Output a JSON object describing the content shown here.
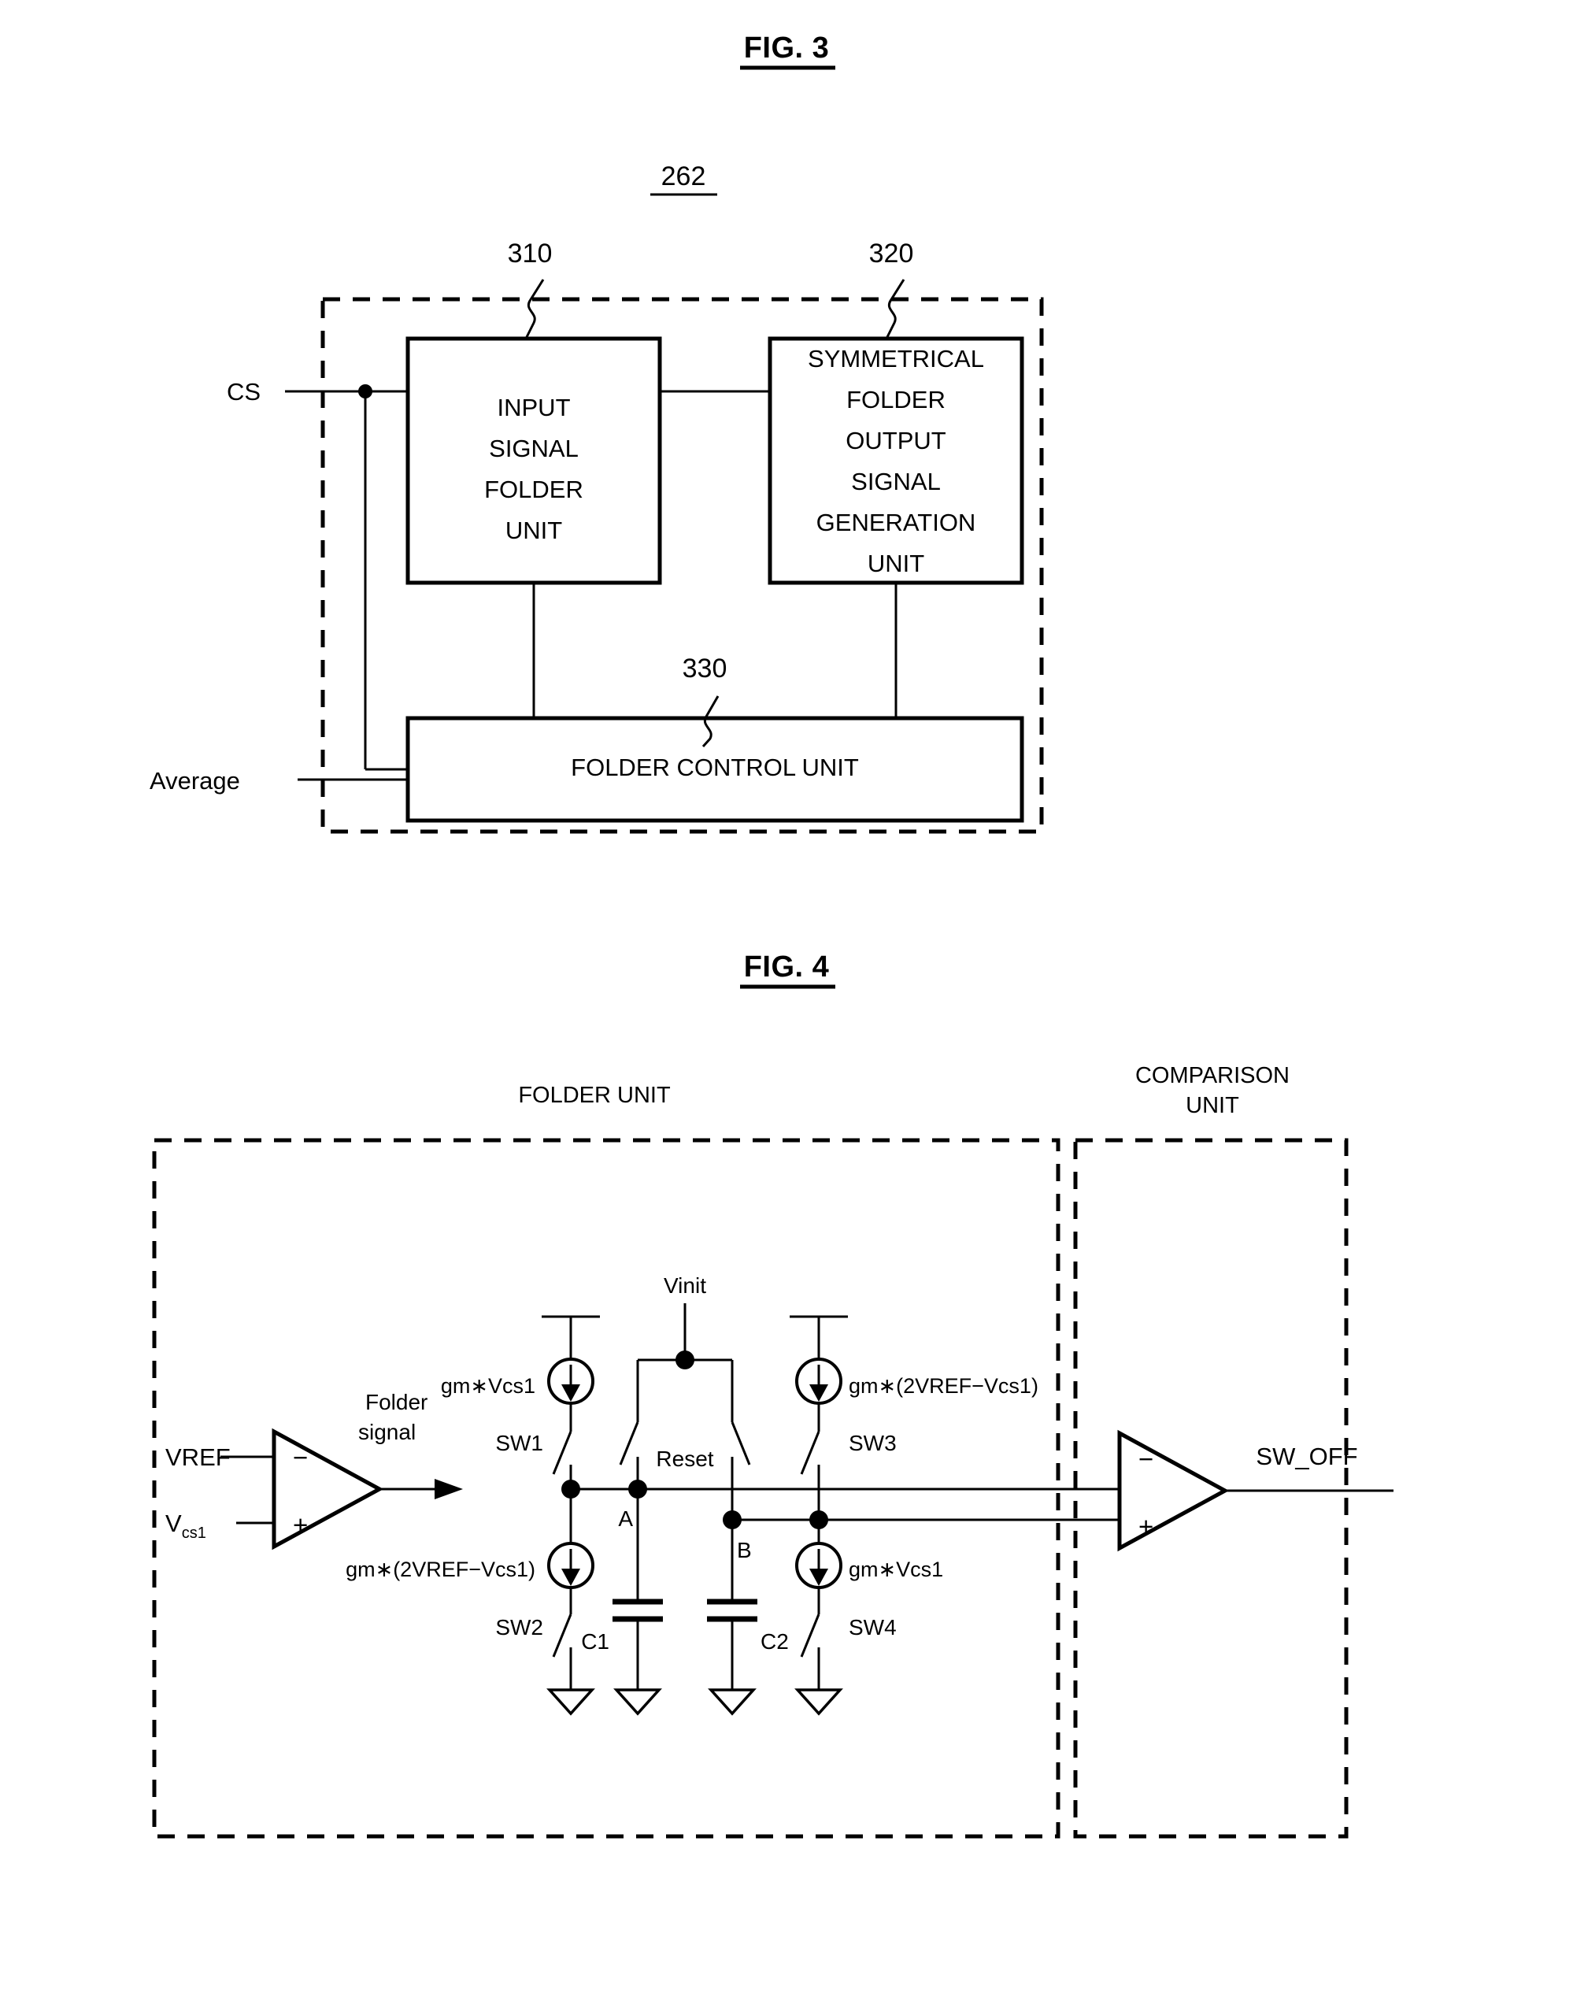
{
  "document": {
    "kind": "patent-drawing-sheet"
  },
  "figure3": {
    "title": "FIG. 3",
    "assembly_ref": "262",
    "refs": {
      "input_folder": "310",
      "symmetrical_gen": "320",
      "folder_control": "330"
    },
    "blocks": {
      "input_signal_folder_unit": [
        "INPUT",
        "SIGNAL",
        "FOLDER",
        "UNIT"
      ],
      "symmetrical_folder_output_signal_generation_unit": [
        "SYMMETRICAL",
        "FOLDER",
        "OUTPUT",
        "SIGNAL",
        "GENERATION",
        "UNIT"
      ],
      "folder_control_unit": "FOLDER CONTROL UNIT"
    },
    "inputs": {
      "cs": "CS",
      "average": "Average"
    }
  },
  "figure4": {
    "title": "FIG. 4",
    "section_headers": {
      "folder_unit": "FOLDER UNIT",
      "comparison_unit_line1": "COMPARISON",
      "comparison_unit_line2": "UNIT"
    },
    "amplifier": {
      "minus_input": "VREF",
      "plus_input_main": "V",
      "plus_input_sub": "cs1",
      "minus_sign": "−",
      "plus_sign": "+",
      "output_line1": "Folder",
      "output_line2": "signal"
    },
    "comparator": {
      "minus_sign": "−",
      "plus_sign": "+",
      "output": "SW_OFF"
    },
    "current_sources": [
      {
        "id": "cs-top-left",
        "label": "gm∗Vcs1",
        "switch": "SW1"
      },
      {
        "id": "cs-bottom-left",
        "label": "gm∗(2VREF−Vcs1)",
        "switch": "SW2"
      },
      {
        "id": "cs-top-right",
        "label": "gm∗(2VREF−Vcs1)",
        "switch": "SW3"
      },
      {
        "id": "cs-bottom-right",
        "label": "gm∗Vcs1",
        "switch": "SW4"
      }
    ],
    "reset": {
      "supply_label": "Vinit",
      "switch_label": "Reset"
    },
    "capacitors": [
      {
        "id": "c1",
        "label": "C1"
      },
      {
        "id": "c2",
        "label": "C2"
      }
    ],
    "nodes": [
      {
        "id": "node-a",
        "label": "A"
      },
      {
        "id": "node-b",
        "label": "B"
      }
    ]
  }
}
